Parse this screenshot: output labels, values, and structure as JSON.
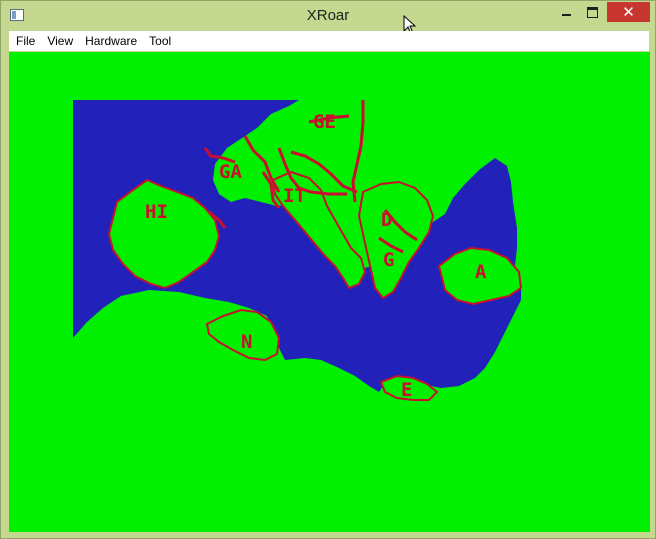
{
  "window": {
    "title": "XRoar",
    "icons": {
      "app": "app-window-icon",
      "minimize": "minimize-icon",
      "maximize": "maximize-icon",
      "close": "close-icon",
      "cursor": "mouse-pointer-icon"
    },
    "close_glyph": "✕"
  },
  "menu": {
    "items": [
      "File",
      "View",
      "Hardware",
      "Tool"
    ]
  },
  "map": {
    "labels": {
      "ge": "GE",
      "ga": "GA",
      "hi": "HI",
      "it": "IT",
      "d": "D",
      "g": "G",
      "a": "A",
      "n": "N",
      "e": "E"
    }
  },
  "colors": {
    "screen_background": "#00f000",
    "sea": "#2222bb",
    "border_red": "#c8102e",
    "land": "#00f000",
    "titlebar": "#c4d98f",
    "close_button": "#c7372f"
  }
}
